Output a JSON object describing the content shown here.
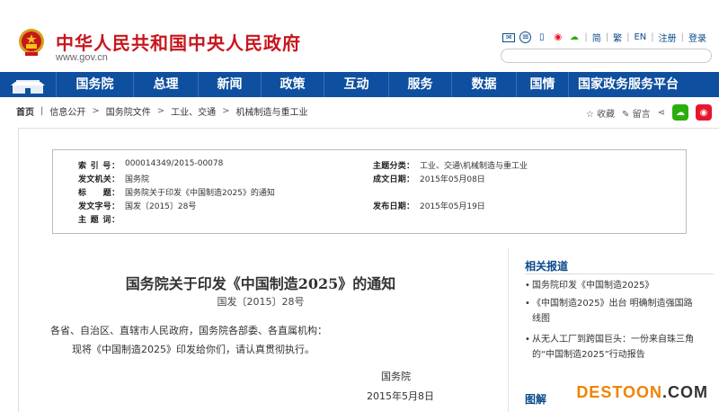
{
  "header": {
    "title": "中华人民共和国中央人民政府",
    "url": "www.gov.cn",
    "links": [
      "简",
      "繁",
      "EN",
      "注册",
      "登录"
    ]
  },
  "nav": [
    "国务院",
    "总理",
    "新闻",
    "政策",
    "互动",
    "服务",
    "数据",
    "国情",
    "国家政务服务平台"
  ],
  "breadcrumb": [
    "首页",
    "信息公开",
    "国务院文件",
    "工业、交通",
    "机械制造与重工业"
  ],
  "share": {
    "collect": "收藏",
    "comment": "留言"
  },
  "meta": {
    "index_label": "索 引 号：",
    "index_value": "000014349/2015-00078",
    "topic_label": "主题分类：",
    "topic_value": "工业、交通\\机械制造与重工业",
    "org_label": "发文机关：",
    "org_value": "国务院",
    "date_label": "成文日期：",
    "date_value": "2015年05月08日",
    "title_label": "标　　题：",
    "title_value": "国务院关于印发《中国制造2025》的通知",
    "num_label": "发文字号：",
    "num_value": "国发〔2015〕28号",
    "pub_label": "发布日期：",
    "pub_value": "2015年05月19日",
    "subject_label": "主 题 词：",
    "subject_value": ""
  },
  "doc": {
    "title": "国务院关于印发《中国制造2025》的通知",
    "number": "国发〔2015〕28号",
    "greeting": "各省、自治区、直辖市人民政府，国务院各部委、各直属机构：",
    "body": "现将《中国制造2025》印发给你们，请认真贯彻执行。",
    "signer": "国务院",
    "date": "2015年5月8日"
  },
  "sidebar": {
    "title": "相关报道",
    "items": [
      "国务院印发《中国制造2025》",
      "《中国制造2025》出台 明确制造强国路线图",
      "从无人工厂到跨国巨头：一份来自珠三角的“中国制造2025”行动报告"
    ],
    "title2": "图解"
  },
  "watermark": {
    "text1": "DESTOON",
    "text2": ".COM"
  },
  "colors": {
    "nav": "#0f4f9f",
    "brand_red": "#c8161d",
    "link_blue": "#0a4a8a"
  }
}
